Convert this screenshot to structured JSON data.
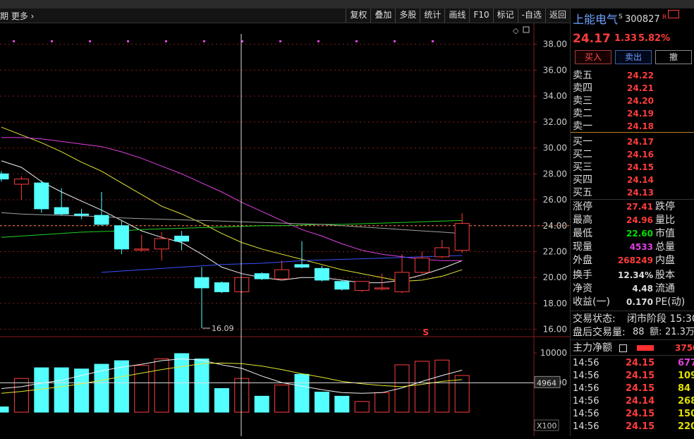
{
  "toolbar": {
    "left_text": "期  更多 ›",
    "buttons": [
      "复权",
      "叠加",
      "多股",
      "统计",
      "画线",
      "F10",
      "标记",
      "-自选",
      "返回"
    ]
  },
  "stock": {
    "name": "上能电气",
    "code": "300827",
    "badges": "S R",
    "price": "24.17",
    "change": "1.33",
    "change_pct": "5.82%"
  },
  "actions": {
    "buy": "买入",
    "sell": "卖出",
    "cancel": "撤"
  },
  "order_book": {
    "asks": [
      {
        "label": "卖五",
        "price": "24.22"
      },
      {
        "label": "卖四",
        "price": "24.21"
      },
      {
        "label": "卖三",
        "price": "24.20"
      },
      {
        "label": "卖二",
        "price": "24.19"
      },
      {
        "label": "卖一",
        "price": "24.18"
      }
    ],
    "bids": [
      {
        "label": "买一",
        "price": "24.17"
      },
      {
        "label": "买二",
        "price": "24.16"
      },
      {
        "label": "买三",
        "price": "24.15"
      },
      {
        "label": "买四",
        "price": "24.14"
      },
      {
        "label": "买五",
        "price": "24.13"
      }
    ]
  },
  "quote": {
    "limit_up_label": "涨停",
    "limit_up": "27.41",
    "limit_down_label": "跌停",
    "high_label": "最高",
    "high": "24.96",
    "vol_ratio_label": "量比",
    "low_label": "最低",
    "low": "22.60",
    "mkt_cap_label": "市值",
    "cur_vol_label": "现量",
    "cur_vol": "4533",
    "total_vol_label": "总量",
    "outer_label": "外盘",
    "outer": "268249",
    "inner_label": "内盘",
    "turnover_label": "换手",
    "turnover": "12.34%",
    "equity_label": "股本",
    "nav_label": "净资",
    "nav": "4.48",
    "float_label": "流通",
    "eps_label": "收益(一)",
    "eps": "0.170",
    "pe_label": "PE(动)"
  },
  "status": {
    "trade_label": "交易状态:",
    "trade_value": "闭市阶段 15:30",
    "after_label": "盘后交易量:",
    "after_vol": "88",
    "amount_label": "额:",
    "amount": "21.3万"
  },
  "main_flow": {
    "label": "主力净额",
    "value": "3750"
  },
  "ticks": [
    {
      "time": "14:56",
      "price": "24.15",
      "vol": "677",
      "vcolor": "#e040e0"
    },
    {
      "time": "14:56",
      "price": "24.15",
      "vol": "109",
      "vcolor": "#e0e000"
    },
    {
      "time": "14:56",
      "price": "24.15",
      "vol": "84",
      "vcolor": "#e0e000"
    },
    {
      "time": "14:56",
      "price": "24.14",
      "vol": "268",
      "vcolor": "#e0e000"
    },
    {
      "time": "14:56",
      "price": "24.15",
      "vol": "150",
      "vcolor": "#e0e000"
    },
    {
      "time": "14:56",
      "price": "24.15",
      "vol": "220",
      "vcolor": "#e0e000"
    }
  ],
  "colors": {
    "up": "#ff3c3c",
    "down": "#54ffff",
    "grid": "#8a1c1c",
    "low_value": "#00e000",
    "cur_vol": "#e040e0",
    "accent_blue": "#6fa0ff"
  },
  "chart_data": {
    "type": "candlestick",
    "price_axis": {
      "ylim": [
        15.6,
        38.8
      ],
      "ticks": [
        "38.00",
        "36.00",
        "34.00",
        "32.00",
        "30.00",
        "28.00",
        "26.00",
        "24.00",
        "22.00",
        "20.00",
        "18.00",
        "16.00"
      ]
    },
    "candles": [
      {
        "o": 28.0,
        "h": 28.2,
        "l": 27.4,
        "c": 27.6
      },
      {
        "o": 27.2,
        "h": 27.8,
        "l": 26.0,
        "c": 27.6
      },
      {
        "o": 27.3,
        "h": 27.5,
        "l": 25.0,
        "c": 25.3
      },
      {
        "o": 25.4,
        "h": 26.9,
        "l": 24.8,
        "c": 24.9
      },
      {
        "o": 24.9,
        "h": 25.3,
        "l": 24.5,
        "c": 24.8
      },
      {
        "o": 24.8,
        "h": 26.6,
        "l": 24.0,
        "c": 24.1
      },
      {
        "o": 24.0,
        "h": 24.4,
        "l": 21.8,
        "c": 22.2
      },
      {
        "o": 22.2,
        "h": 23.3,
        "l": 22.0,
        "c": 22.2
      },
      {
        "o": 22.2,
        "h": 23.5,
        "l": 21.3,
        "c": 23.0
      },
      {
        "o": 23.2,
        "h": 23.6,
        "l": 22.1,
        "c": 22.8
      },
      {
        "o": 20.0,
        "h": 20.8,
        "l": 16.09,
        "c": 19.2
      },
      {
        "o": 19.6,
        "h": 19.7,
        "l": 18.8,
        "c": 18.9
      },
      {
        "o": 18.9,
        "h": 20.0,
        "l": 18.8,
        "c": 20.0
      },
      {
        "o": 20.3,
        "h": 20.4,
        "l": 19.8,
        "c": 19.9
      },
      {
        "o": 19.9,
        "h": 21.3,
        "l": 19.8,
        "c": 20.6
      },
      {
        "o": 21.0,
        "h": 22.8,
        "l": 20.7,
        "c": 20.8
      },
      {
        "o": 20.7,
        "h": 20.9,
        "l": 19.7,
        "c": 19.8
      },
      {
        "o": 19.7,
        "h": 19.8,
        "l": 19.0,
        "c": 19.1
      },
      {
        "o": 19.0,
        "h": 19.7,
        "l": 18.9,
        "c": 19.7
      },
      {
        "o": 19.2,
        "h": 20.3,
        "l": 19.0,
        "c": 19.2
      },
      {
        "o": 18.9,
        "h": 21.8,
        "l": 18.8,
        "c": 20.4
      },
      {
        "o": 20.4,
        "h": 22.0,
        "l": 20.3,
        "c": 21.5
      },
      {
        "o": 21.6,
        "h": 22.9,
        "l": 21.5,
        "c": 22.3
      },
      {
        "o": 22.1,
        "h": 24.96,
        "l": 21.9,
        "c": 24.17
      }
    ],
    "ma": [
      {
        "color": "#f0f0f0",
        "values": [
          29.0,
          28.5,
          27.4,
          26.6,
          25.9,
          25.2,
          24.4,
          23.6,
          23.1,
          22.7,
          21.8,
          20.8,
          20.3,
          20.0,
          19.8,
          20.0,
          20.0,
          19.8,
          19.6,
          19.6,
          19.8,
          20.2,
          20.7,
          21.3
        ]
      },
      {
        "color": "#e6e632",
        "values": [
          31.6,
          31.0,
          30.4,
          29.7,
          28.9,
          28.2,
          27.3,
          26.4,
          25.5,
          24.9,
          24.2,
          23.4,
          22.7,
          22.2,
          21.8,
          21.4,
          21.0,
          20.6,
          20.3,
          20.0,
          19.7,
          19.8,
          20.1,
          20.6
        ]
      },
      {
        "color": "#e040e0",
        "values": [
          30.8,
          30.8,
          30.7,
          30.5,
          30.3,
          30.1,
          29.7,
          29.2,
          28.6,
          28.0,
          27.3,
          26.6,
          25.8,
          25.1,
          24.4,
          23.7,
          23.2,
          22.6,
          22.1,
          21.8,
          21.6,
          21.4,
          21.3,
          21.3
        ]
      },
      {
        "color": "#3c50ff",
        "x0": 5,
        "values": [
          20.4,
          20.5,
          20.6,
          20.7,
          20.8,
          20.9,
          21.0,
          21.05,
          21.1,
          21.2,
          21.3,
          21.35,
          21.4,
          21.45,
          21.5,
          21.55,
          21.6,
          21.65,
          21.7
        ]
      },
      {
        "color": "#20d020",
        "values": [
          23.1,
          23.2,
          23.3,
          23.4,
          23.5,
          23.55,
          23.6,
          23.7,
          23.75,
          23.8,
          23.85,
          23.9,
          23.95,
          24.0,
          24.0,
          24.05,
          24.1,
          24.1,
          24.15,
          24.2,
          24.25,
          24.3,
          24.35,
          24.4
        ]
      },
      {
        "color": "#a0a0a0",
        "values": [
          25.0,
          24.9,
          24.85,
          24.8,
          24.75,
          24.7,
          24.6,
          24.55,
          24.5,
          24.45,
          24.4,
          24.35,
          24.3,
          24.25,
          24.2,
          24.15,
          24.1,
          24.0,
          23.9,
          23.8,
          23.7,
          23.6,
          23.5,
          23.4
        ]
      }
    ],
    "ref_price": 24.0,
    "low_label": "16.09",
    "low_index": 10,
    "volume": {
      "ylim": [
        0,
        12400
      ],
      "ticks": [
        "10000",
        "5000"
      ],
      "cursor_value": "4964",
      "unit": "X100",
      "values": [
        900,
        5700,
        7500,
        7500,
        7300,
        8100,
        8700,
        7900,
        9000,
        9900,
        9000,
        4000,
        5700,
        2700,
        4600,
        6400,
        3400,
        2700,
        1800,
        3300,
        8000,
        8600,
        8800,
        6200
      ],
      "ma": [
        {
          "color": "#f0f0f0",
          "values": [
            4000,
            4300,
            4900,
            5400,
            6200,
            7000,
            7600,
            8100,
            8700,
            9000,
            8800,
            8000,
            7400,
            6100,
            5000,
            4400,
            3800,
            3300,
            3200,
            3300,
            4100,
            5200,
            6200,
            7100
          ]
        },
        {
          "color": "#e6e632",
          "values": [
            3200,
            3500,
            3900,
            4300,
            4800,
            5400,
            6000,
            6600,
            7200,
            7700,
            8200,
            8300,
            8200,
            7800,
            7200,
            6500,
            5900,
            5200,
            4800,
            4500,
            4300,
            4700,
            5200,
            5500
          ]
        }
      ]
    }
  }
}
